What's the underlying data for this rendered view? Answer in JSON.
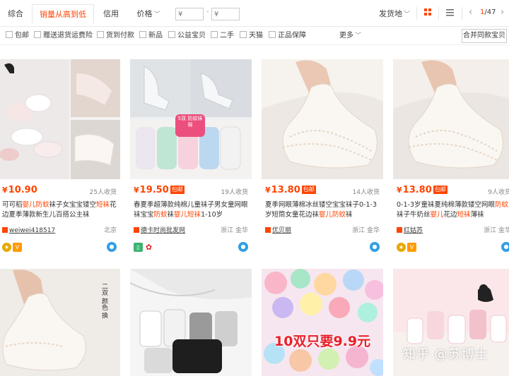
{
  "sortbar": {
    "tabs": [
      {
        "label": "综合"
      },
      {
        "label": "销量从高到低"
      },
      {
        "label": "信用"
      },
      {
        "label": "价格"
      }
    ],
    "price_min_placeholder": "¥",
    "price_max_placeholder": "¥",
    "price_dash": "-",
    "ship_from": "发货地",
    "page_current": "1",
    "page_total": "/47"
  },
  "filters": {
    "items": [
      "包邮",
      "赠送退货运费险",
      "货到付款",
      "新品",
      "公益宝贝",
      "二手",
      "天猫",
      "正品保障"
    ],
    "more": "更多",
    "merge": "合并同款宝贝"
  },
  "products": [
    {
      "price": "10.90",
      "currency": "¥",
      "tag": "",
      "sold": "25人收货",
      "title_parts": [
        [
          "可可稻",
          ""
        ],
        [
          "婴儿防蚊",
          "hl"
        ],
        [
          "袜子女宝宝镂空",
          ""
        ],
        [
          "短袜",
          "hl"
        ],
        [
          "花边夏季薄款新生儿百搭公主袜",
          ""
        ]
      ],
      "shop": "weiwei418517",
      "location": "北京",
      "badges": [
        "gold-medal-icon",
        "vip-icon"
      ]
    },
    {
      "price": "19.50",
      "currency": "¥",
      "tag": "包邮",
      "sold": "19人收货",
      "title_parts": [
        [
          "春夏季超薄款纯棉儿童袜子男女童网眼袜宝宝",
          ""
        ],
        [
          "防蚊",
          "hl"
        ],
        [
          "袜",
          ""
        ],
        [
          "婴儿短袜",
          "hl"
        ],
        [
          "1-10岁",
          ""
        ]
      ],
      "shop": "德卡时尚批发网",
      "location": "浙江 金华",
      "badges": [
        "phone-icon",
        "flower-icon"
      ]
    },
    {
      "price": "13.80",
      "currency": "¥",
      "tag": "包邮",
      "sold": "14人收货",
      "title_parts": [
        [
          "夏季网眼薄棉冰丝镂空宝宝袜子0-1-3岁短筒女童花边袜",
          ""
        ],
        [
          "婴儿防蚊",
          "hl"
        ],
        [
          "袜",
          ""
        ]
      ],
      "shop": "优贝丽",
      "location": "浙江 金华",
      "badges": []
    },
    {
      "price": "13.80",
      "currency": "¥",
      "tag": "包邮",
      "sold": "9人收货",
      "title_parts": [
        [
          "0-1-3岁童袜夏纯棉薄款镂空网眼",
          ""
        ],
        [
          "防蚊",
          "hl"
        ],
        [
          "袜子牛奶丝",
          ""
        ],
        [
          "婴儿",
          "hl"
        ],
        [
          "花边",
          ""
        ],
        [
          "短袜",
          "hl"
        ],
        [
          "薄袜",
          ""
        ]
      ],
      "shop": "红姑苏",
      "location": "浙江 金华",
      "badges": [
        "gold-medal-icon",
        "vip-icon"
      ]
    }
  ],
  "images": {
    "img2_label": "5双 防蚊袜 棉",
    "img5_label": "二双 颜色 换",
    "img7_label": "10双只要9.9元"
  },
  "watermark": "知乎 @苏博士",
  "colors": {
    "accent": "#ff4400",
    "link": "#3c3c3c",
    "ww": "#2f9fe6"
  }
}
